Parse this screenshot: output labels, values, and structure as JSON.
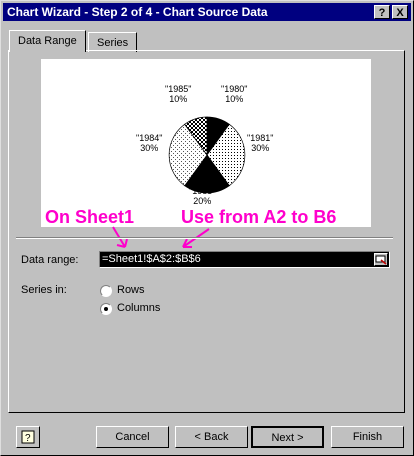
{
  "window": {
    "title": "Chart Wizard - Step 2 of 4 - Chart Source Data",
    "help_btn": "?",
    "close_btn": "X"
  },
  "tabs": [
    {
      "label": "Data Range",
      "active": true
    },
    {
      "label": "Series",
      "active": false
    }
  ],
  "preview": {
    "labels": [
      {
        "name": "\"1985\"",
        "pct": "10%"
      },
      {
        "name": "\"1980\"",
        "pct": "10%"
      },
      {
        "name": "\"1984\"",
        "pct": "30%"
      },
      {
        "name": "\"1981\"",
        "pct": "30%"
      },
      {
        "name": "\"1983\"",
        "pct": "20%"
      }
    ]
  },
  "annotations": {
    "sheet": "On Sheet1",
    "range": "Use from A2 to B6"
  },
  "data_range": {
    "label": "Data range:",
    "value": "=Sheet1!$A$2:$B$6"
  },
  "series_in": {
    "label": "Series in:",
    "options": [
      "Rows",
      "Columns"
    ],
    "selected": "Columns"
  },
  "buttons": {
    "help": "?",
    "cancel": "Cancel",
    "back": "< Back",
    "next": "Next >",
    "finish": "Finish"
  }
}
